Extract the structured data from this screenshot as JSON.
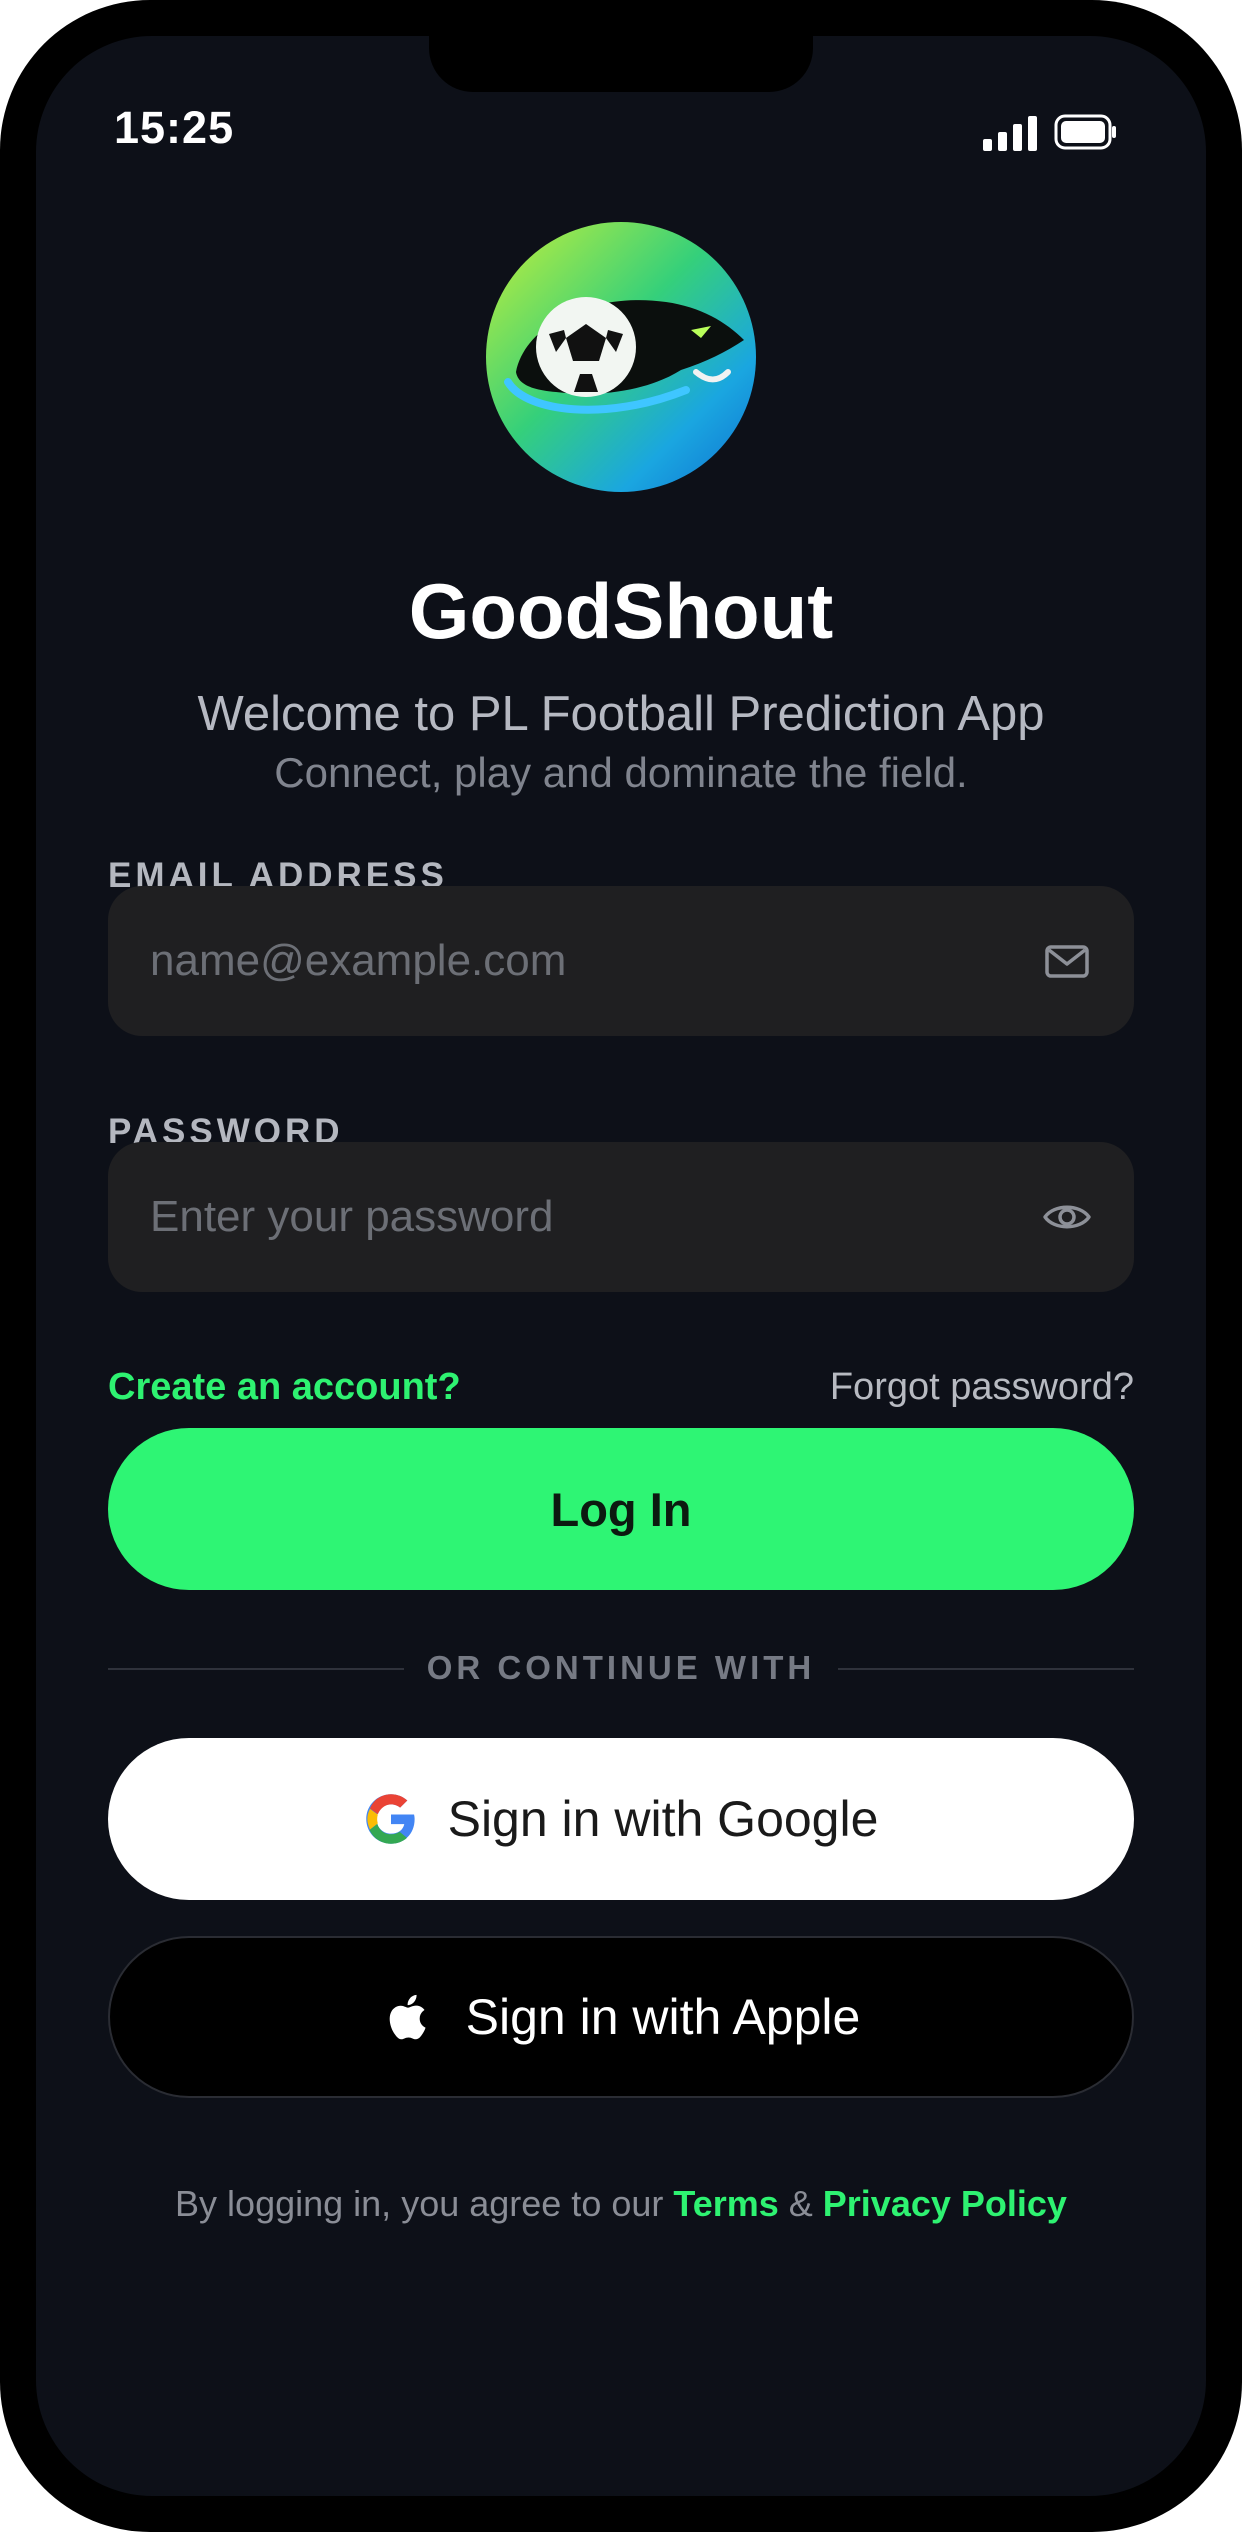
{
  "status_bar": {
    "time": "15:25",
    "signal_icon": "cellular-signal-icon",
    "battery_icon": "battery-full-icon"
  },
  "branding": {
    "logo_icon": "football-panther-logo-icon",
    "app_name": "GoodShout",
    "welcome": "Welcome to PL Football Prediction App",
    "tagline": "Connect, play and dominate the field."
  },
  "email": {
    "label": "EMAIL ADDRESS",
    "placeholder": "name@example.com",
    "value": "",
    "icon": "envelope-icon"
  },
  "password": {
    "label": "PASSWORD",
    "placeholder": "Enter your password",
    "value": "",
    "icon": "eye-icon"
  },
  "links": {
    "create_account": "Create an account?",
    "forgot_password": "Forgot password?"
  },
  "login_button": "Log In",
  "divider": "OR CONTINUE WITH",
  "social": {
    "google": {
      "label": "Sign in with Google",
      "icon": "google-icon"
    },
    "apple": {
      "label": "Sign in with Apple",
      "icon": "apple-icon"
    }
  },
  "legal": {
    "prefix": "By logging in, you agree to our ",
    "terms": "Terms",
    "amp": " & ",
    "privacy": "Privacy Policy"
  },
  "colors": {
    "accent": "#2ef574",
    "background": "#0d1018",
    "input_bg": "#1f1f21"
  }
}
